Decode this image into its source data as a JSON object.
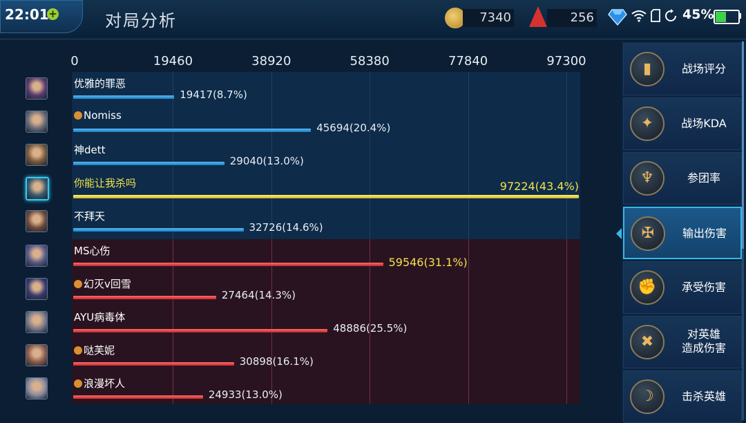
{
  "status_bar": {
    "time": "22:01",
    "battery_percent": "45%",
    "battery_level": 0.45
  },
  "header": {
    "title": "对局分析",
    "coins": "7340",
    "gems": "256"
  },
  "chart_data": {
    "type": "bar",
    "orientation": "horizontal",
    "xlim": [
      0,
      97300
    ],
    "ticks": [
      "0",
      "19460",
      "38920",
      "58380",
      "77840",
      "97300"
    ],
    "ally_team": [
      {
        "name": "优雅的罪恶",
        "value": 19417,
        "label": "19417(8.7%)"
      },
      {
        "name": "Nomiss",
        "value": 45694,
        "label": "45694(20.4%)",
        "tag": true
      },
      {
        "name": "神dett",
        "value": 29040,
        "label": "29040(13.0%)"
      },
      {
        "name": "你能让我杀吗",
        "value": 97224,
        "label": "97224(43.4%)",
        "highlight": true
      },
      {
        "name": "不拜天",
        "value": 32726,
        "label": "32726(14.6%)"
      }
    ],
    "enemy_team": [
      {
        "name": "MS心伤",
        "value": 59546,
        "label": "59546(31.1%)",
        "highlight": true
      },
      {
        "name": "幻灭v回雪",
        "value": 27464,
        "label": "27464(14.3%)",
        "tag": true
      },
      {
        "name": "AYU病毒体",
        "value": 48886,
        "label": "48886(25.5%)"
      },
      {
        "name": "哒芙妮",
        "value": 30898,
        "label": "30898(16.1%)",
        "tag": true
      },
      {
        "name": "浪漫坏人",
        "value": 24933,
        "label": "24933(13.0%)",
        "tag": true
      }
    ],
    "colors": {
      "ally": "#2a9be0",
      "self": "#f2e24b",
      "enemy": "#e23c3c"
    }
  },
  "side_menu": {
    "items": [
      {
        "label": "战场评分",
        "icon": "shield-icon"
      },
      {
        "label": "战场KDA",
        "icon": "dragon-icon"
      },
      {
        "label": "参团率",
        "icon": "banner-icon"
      },
      {
        "label": "输出伤害",
        "icon": "sword-icon",
        "active": true
      },
      {
        "label": "承受伤害",
        "icon": "fist-icon"
      },
      {
        "label": "对英雄\n造成伤害",
        "icon": "crossed-swords-icon"
      },
      {
        "label": "击杀英雄",
        "icon": "scythe-icon"
      }
    ]
  }
}
